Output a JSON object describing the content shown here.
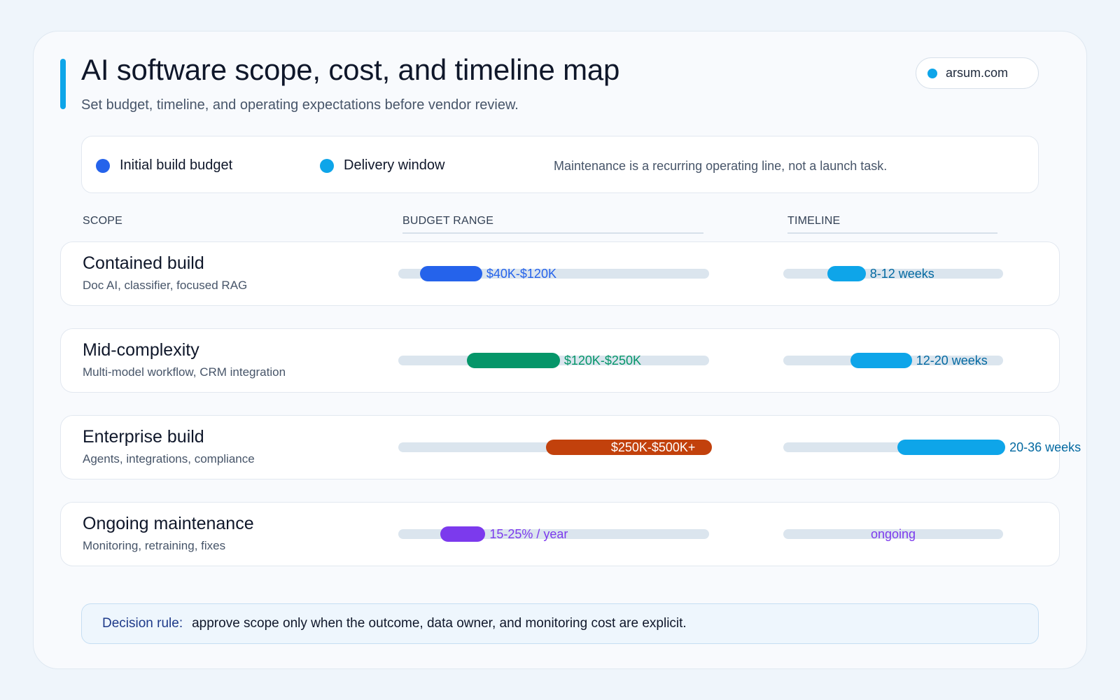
{
  "header": {
    "title": "AI software scope, cost, and timeline map",
    "subtitle": "Set budget, timeline, and operating expectations before vendor review.",
    "domain": "arsum.com"
  },
  "legend": {
    "items": [
      {
        "label": "Initial build budget",
        "color": "#2563eb"
      },
      {
        "label": "Delivery window",
        "color": "#0ea5e9"
      }
    ],
    "note": "Maintenance is a recurring operating line, not a launch task."
  },
  "columns": {
    "scope": "SCOPE",
    "budget": "BUDGET RANGE",
    "timeline": "TIMELINE"
  },
  "chart_data": {
    "type": "bar",
    "subtype": "range",
    "categories": [
      "Contained build",
      "Mid-complexity",
      "Enterprise build",
      "Ongoing maintenance"
    ],
    "descriptions": [
      "Doc AI, classifier, focused RAG",
      "Multi-model workflow, CRM integration",
      "Agents, integrations, compliance",
      "Monitoring, retraining, fixes"
    ],
    "budget": [
      {
        "label": "$40K-$120K",
        "range": [
          0.07,
          0.27
        ],
        "color": "#2563eb",
        "label_position": "outside"
      },
      {
        "label": "$120K-$250K",
        "range": [
          0.22,
          0.52
        ],
        "color": "#059669",
        "label_position": "outside"
      },
      {
        "label": "$250K-$500K+",
        "range": [
          0.475,
          1.01
        ],
        "color": "#c2410c",
        "label_position": "inside"
      },
      {
        "label": "15-25% / year",
        "range": [
          0.135,
          0.28
        ],
        "color": "#7c3aed",
        "label_position": "outside"
      }
    ],
    "timeline": [
      {
        "label": "8-12 weeks",
        "range": [
          0.2,
          0.375
        ],
        "color": "#0ea5e9",
        "label_color": "#0369a1"
      },
      {
        "label": "12-20 weeks",
        "range": [
          0.305,
          0.585
        ],
        "color": "#0ea5e9",
        "label_color": "#0369a1"
      },
      {
        "label": "20-36 weeks",
        "range": [
          0.52,
          1.01
        ],
        "color": "#0ea5e9",
        "label_color": "#0369a1"
      },
      {
        "label": "ongoing",
        "range": null,
        "color": "#7c3aed",
        "label_color": "#7c3aed"
      }
    ],
    "grid": false,
    "legend_position": "top"
  },
  "decision_rule": {
    "label": "Decision rule:",
    "text": "approve scope only when the outcome, data owner, and monitoring cost are explicit."
  }
}
